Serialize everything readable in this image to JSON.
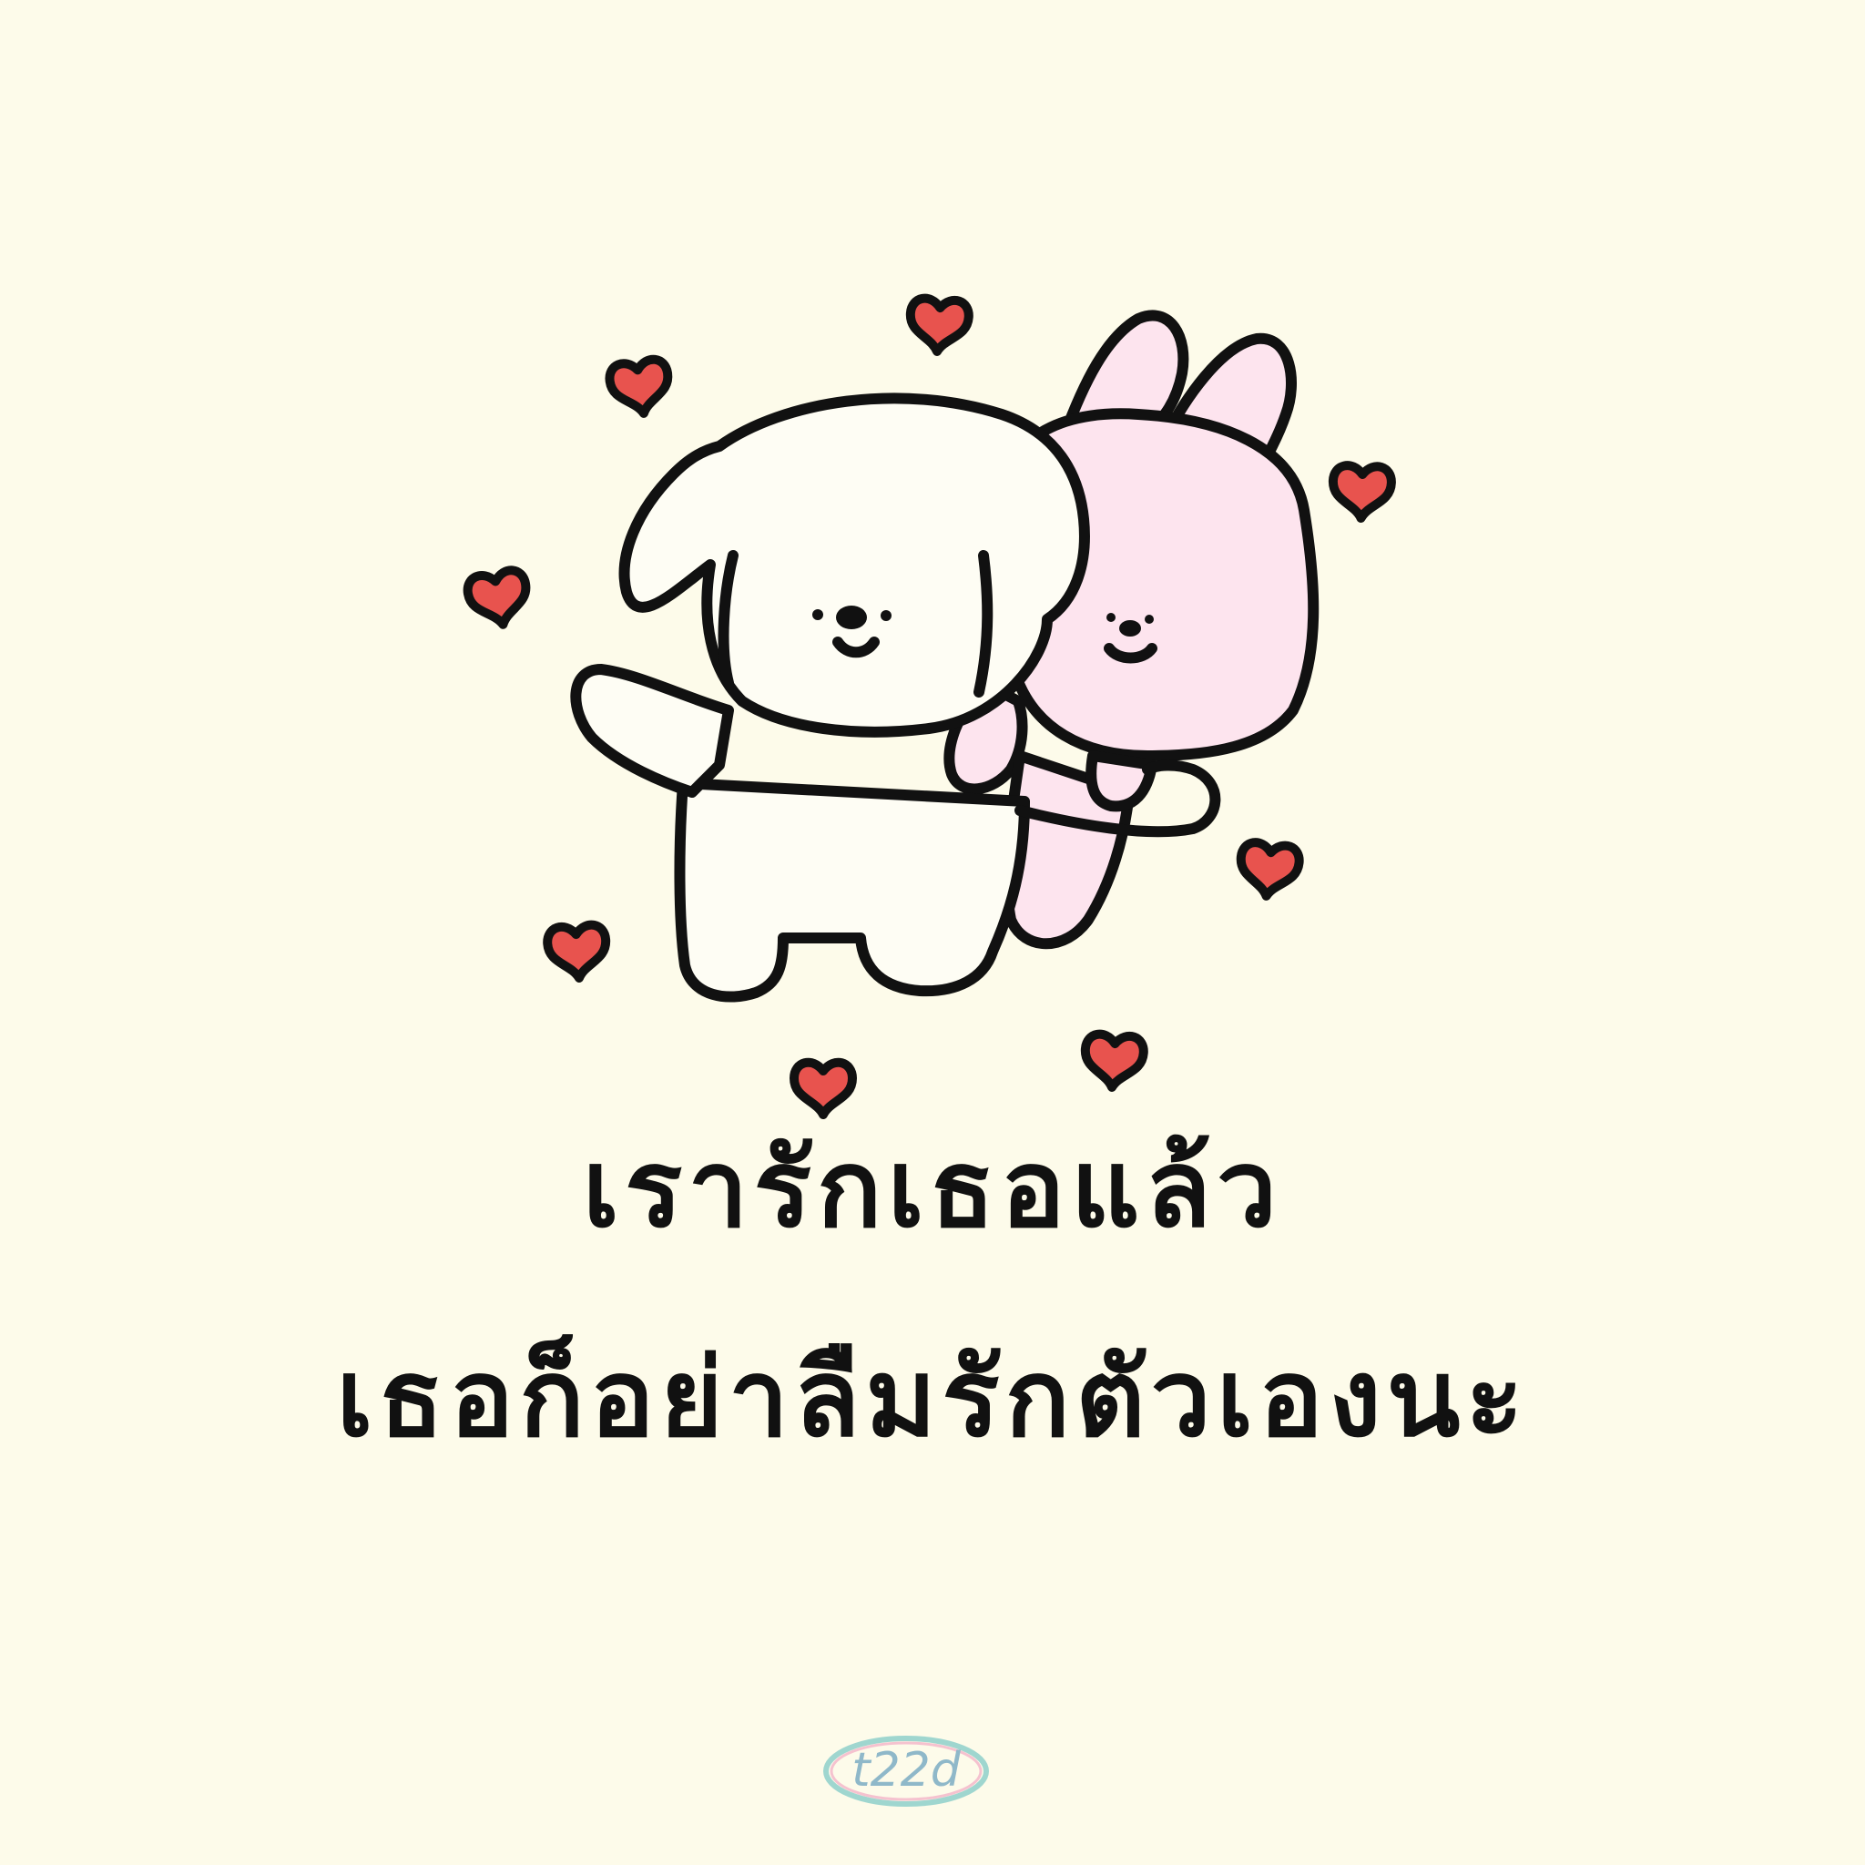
{
  "message": {
    "line1": "เรารักเธอแล้ว",
    "line2": "เธอก็อย่าลืมรักตัวเองนะ"
  },
  "logo": {
    "text": "t22d"
  },
  "colors": {
    "background": "#fdfbea",
    "heart": "#e8534e",
    "outline": "#111111",
    "bunny": "#fde4ee",
    "dog": "#fefdf4"
  }
}
